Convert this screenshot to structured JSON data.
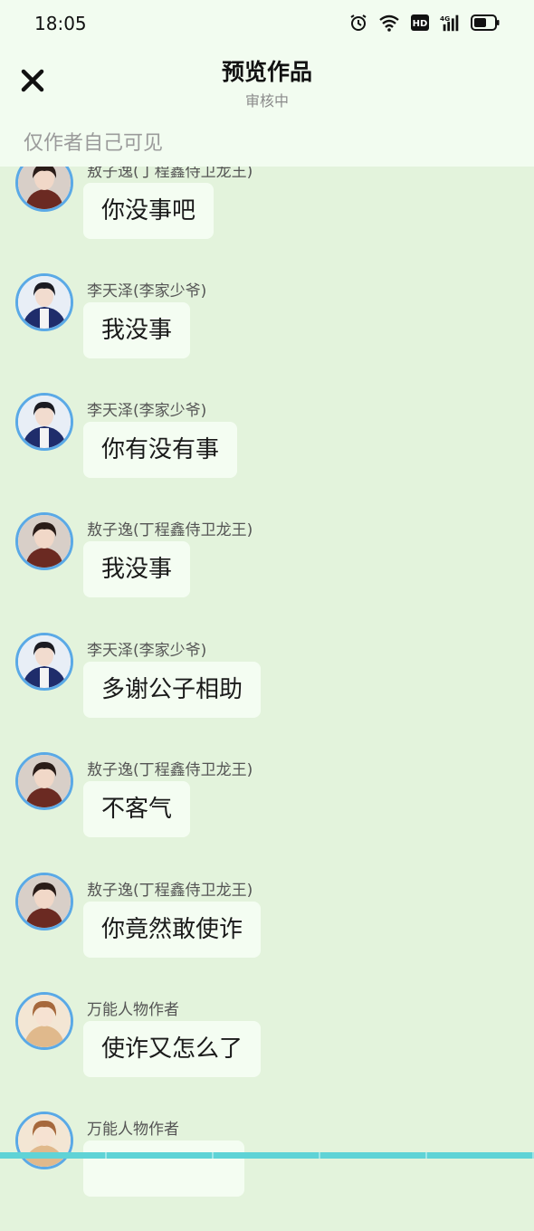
{
  "status": {
    "time": "18:05",
    "net": "4G",
    "hd": "HD"
  },
  "header": {
    "title": "预览作品",
    "subtitle": "审核中",
    "notice": "仅作者自己可见"
  },
  "messages": [
    {
      "speaker": "敖子逸(丁程鑫侍卫龙王)",
      "text": "你没事吧",
      "avatar": "character-a-avatar"
    },
    {
      "speaker": "李天泽(李家少爷)",
      "text": "我没事",
      "avatar": "character-b-avatar"
    },
    {
      "speaker": "李天泽(李家少爷)",
      "text": "你有没有事",
      "avatar": "character-b-avatar"
    },
    {
      "speaker": "敖子逸(丁程鑫侍卫龙王)",
      "text": "我没事",
      "avatar": "character-a-avatar"
    },
    {
      "speaker": "李天泽(李家少爷)",
      "text": "多谢公子相助",
      "avatar": "character-b-avatar"
    },
    {
      "speaker": "敖子逸(丁程鑫侍卫龙王)",
      "text": "不客气",
      "avatar": "character-a-avatar"
    },
    {
      "speaker": "敖子逸(丁程鑫侍卫龙王)",
      "text": "你竟然敢使诈",
      "avatar": "character-a-avatar"
    },
    {
      "speaker": "万能人物作者",
      "text": "使诈又怎么了",
      "avatar": "author-avatar"
    },
    {
      "speaker": "万能人物作者",
      "text": "",
      "avatar": "author-avatar"
    }
  ],
  "colors": {
    "background": "#e3f3dc",
    "header": "#f2fcf0",
    "bubble": "#f4fdf2",
    "avatar_ring": "#5aa9e6"
  }
}
